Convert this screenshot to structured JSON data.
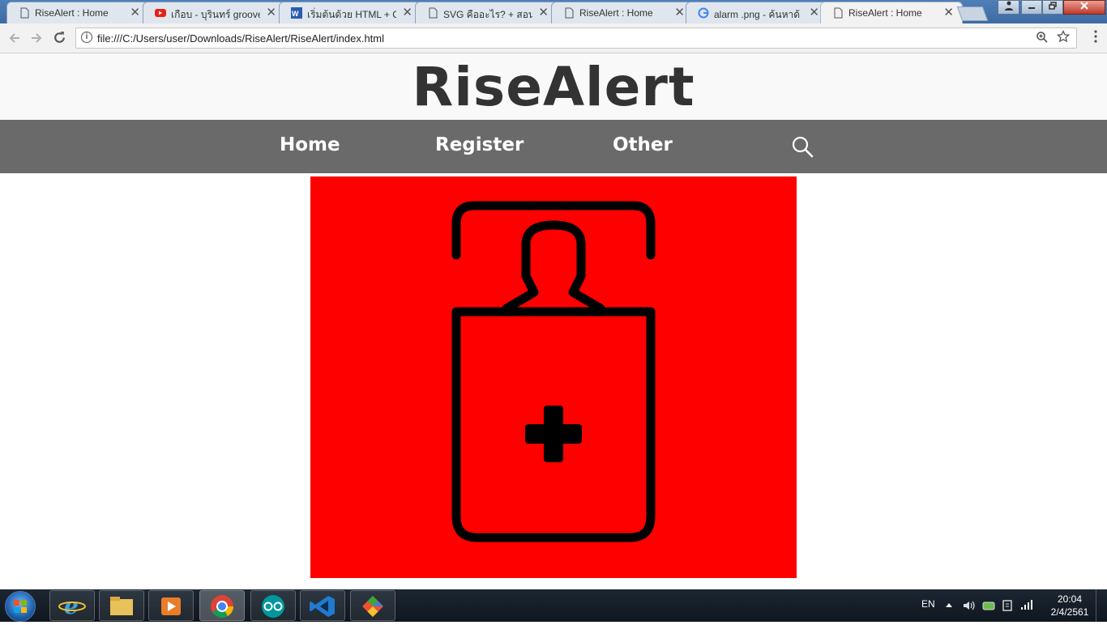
{
  "browser": {
    "tabs": [
      {
        "title": "RiseAlert : Home",
        "icon": "page-icon"
      },
      {
        "title": "เกือบ - บุรินทร์ groove",
        "icon": "youtube-icon"
      },
      {
        "title": "เริ่มต้นด้วย HTML + C",
        "icon": "w3schools-icon"
      },
      {
        "title": "SVG คืออะไร? + สอน",
        "icon": "page-icon"
      },
      {
        "title": "RiseAlert : Home",
        "icon": "page-icon"
      },
      {
        "title": "alarm .png - ค้นหาด้",
        "icon": "google-icon"
      },
      {
        "title": "RiseAlert : Home",
        "icon": "page-icon",
        "active": true
      }
    ],
    "close_glyph": "✕",
    "address_url": "file:///C:/Users/user/Downloads/RiseAlert/RiseAlert/index.html"
  },
  "site": {
    "title": "RiseAlert",
    "nav": [
      "Home",
      "Register",
      "Other"
    ],
    "search_icon": "search-icon",
    "hero": {
      "icon": "patient-bed-medical-icon",
      "background": "#ff0000"
    }
  },
  "taskbar": {
    "apps": [
      "internet-explorer-icon",
      "file-explorer-icon",
      "media-player-icon",
      "chrome-icon",
      "arduino-icon",
      "vscode-icon",
      "git-icon"
    ],
    "language": "EN",
    "time": "20:04",
    "date": "2/4/2561"
  },
  "colors": {
    "navbar": "#6a6a6a",
    "header": "#f9f9f9",
    "title": "#333333",
    "hero": "#ff0000"
  }
}
